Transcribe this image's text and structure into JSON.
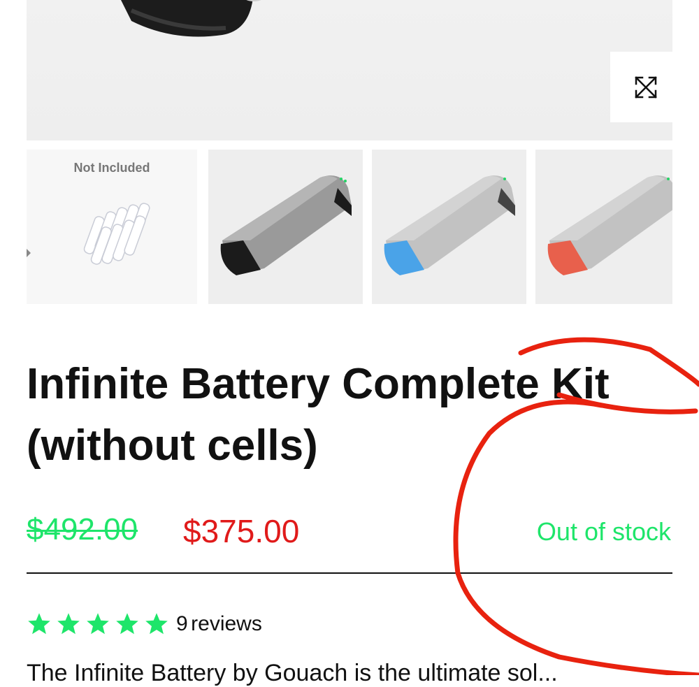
{
  "gallery": {
    "zoom_icon": "expand-icon",
    "thumbnails": [
      {
        "caption": "Not Included"
      },
      {
        "caption": ""
      },
      {
        "caption": ""
      },
      {
        "caption": ""
      }
    ]
  },
  "product": {
    "title_line1": "Infinite Battery Complete Kit",
    "title_line2": "(without cells)",
    "price_old": "$492.00",
    "price_new": "$375.00",
    "stock_status": "Out of stock",
    "rating_stars": 5,
    "reviews_count": "9",
    "reviews_label": "reviews",
    "description_preview": "The Infinite Battery by Gouach is the ultimate sol..."
  },
  "colors": {
    "accent_green": "#1ee56a",
    "sale_red": "#e01a1a",
    "annotation_red": "#e8220f"
  }
}
